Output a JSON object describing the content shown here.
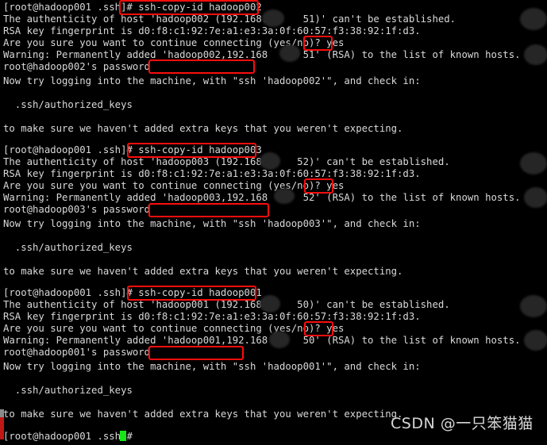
{
  "terminal": {
    "title": "root@hadoop001:~/.ssh",
    "colors": {
      "background": "#000000",
      "foreground": "#d9d9d9",
      "annotation": "#fc0d0d",
      "cursor": "#17e617",
      "redaction": "#2c2c2c"
    },
    "prompt": "[root@hadoop001 .ssh]#",
    "lines": [
      "[root@hadoop001 .ssh]# ssh-copy-id hadoop002",
      "The authenticity of host 'hadoop002 (192.168.      51)' can't be established.",
      "RSA key fingerprint is d0:f8:c1:92:7e:a1:e3:3a:0f:60:57:f3:38:92:1f:d3.",
      "Are you sure you want to continue connecting (yes/no)? yes",
      "Warning: Permanently added 'hadoop002,192.168      51' (RSA) to the list of known hosts.",
      "root@hadoop002's password:",
      "Now try logging into the machine, with \"ssh 'hadoop002'\", and check in:",
      "",
      "  .ssh/authorized_keys",
      "",
      "to make sure we haven't added extra keys that you weren't expecting.",
      "",
      "[root@hadoop001 .ssh]# ssh-copy-id hadoop003",
      "The authenticity of host 'hadoop003 (192.168      52)' can't be established.",
      "RSA key fingerprint is d0:f8:c1:92:7e:a1:e3:3a:0f:60:57:f3:38:92:1f:d3.",
      "Are you sure you want to continue connecting (yes/no)? yes",
      "Warning: Permanently added 'hadoop003,192.168      52' (RSA) to the list of known hosts.",
      "root@hadoop003's password:",
      "Now try logging into the machine, with \"ssh 'hadoop003'\", and check in:",
      "",
      "  .ssh/authorized_keys",
      "",
      "to make sure we haven't added extra keys that you weren't expecting.",
      "",
      "[root@hadoop001 .ssh]# ssh-copy-id hadoop001",
      "The authenticity of host 'hadoop001 (192.168      50)' can't be established.",
      "RSA key fingerprint is d0:f8:c1:92:7e:a1:e3:3a:0f:60:57:f3:38:92:1f:d3.",
      "Are you sure you want to continue connecting (yes/no)? yes",
      "Warning: Permanently added 'hadoop001,192.168      50' (RSA) to the list of known hosts.",
      "root@hadoop001's password:",
      "Now try logging into the machine, with \"ssh 'hadoop001'\", and check in:",
      "",
      "  .ssh/authorized_keys",
      "",
      "to make sure we haven't added extra keys that you weren't expecting.",
      "",
      "[root@hadoop001 .ssh]#"
    ],
    "segments": {
      "prompt_1": "[root@hadoop001 .ssh]",
      "cmd_1": "# ssh-copy-id hadoop002",
      "cmd_2": "ssh-copy-id hadoop003",
      "cmd_3": "ssh-copy-id hadoop001",
      "answer": "yes",
      "password_prompt_1": "root@hadoop002's password:",
      "password_prompt_2": "root@hadoop003's password:",
      "password_prompt_3": "root@hadoop001's password:"
    }
  },
  "watermark": {
    "text": "CSDN @一只笨猫猫"
  },
  "annotations": {
    "command_boxes": [
      "# ssh-copy-id hadoop002",
      "ssh-copy-id hadoop003",
      "ssh-copy-id hadoop001"
    ],
    "answer_boxes": [
      "yes",
      "yes",
      "yes"
    ],
    "password_boxes": [
      "",
      "",
      ""
    ]
  }
}
